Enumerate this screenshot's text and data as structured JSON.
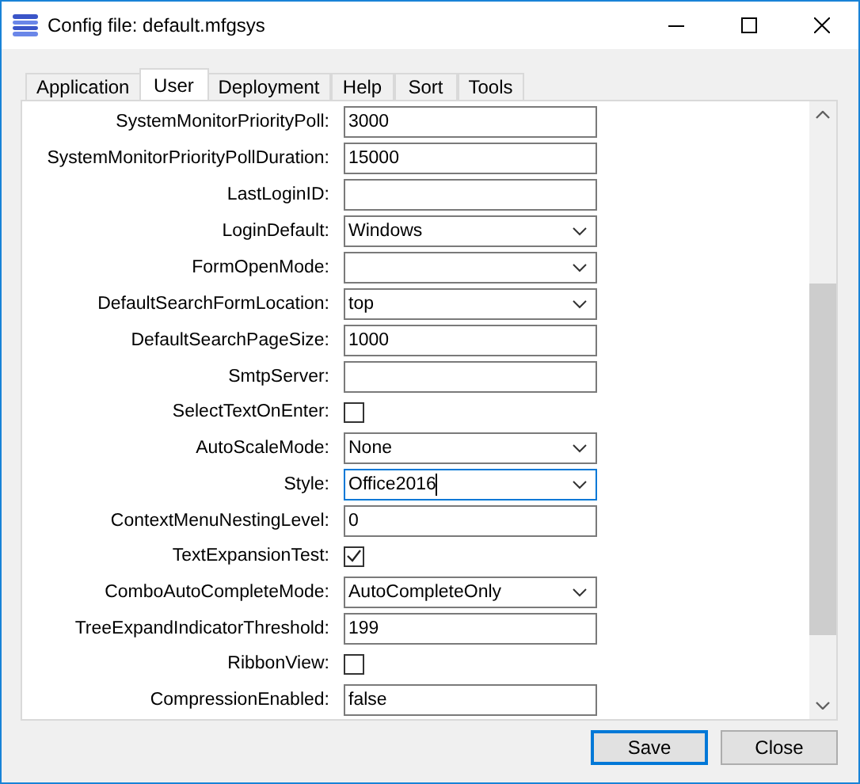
{
  "window": {
    "title": "Config file: default.mfgsys"
  },
  "tabs": [
    {
      "label": "Application",
      "selected": false
    },
    {
      "label": "User",
      "selected": true
    },
    {
      "label": "Deployment",
      "selected": false
    },
    {
      "label": "Help",
      "selected": false
    },
    {
      "label": "Sort",
      "selected": false
    },
    {
      "label": "Tools",
      "selected": false
    }
  ],
  "settings": [
    {
      "label": "SystemMonitorPriorityPoll:",
      "kind": "text",
      "value": "3000"
    },
    {
      "label": "SystemMonitorPriorityPollDuration:",
      "kind": "text",
      "value": "15000"
    },
    {
      "label": "LastLoginID:",
      "kind": "text"
    },
    {
      "label": "LoginDefault:",
      "kind": "combo",
      "value": "Windows"
    },
    {
      "label": "FormOpenMode:",
      "kind": "combo"
    },
    {
      "label": "DefaultSearchFormLocation:",
      "kind": "combo",
      "value": "top"
    },
    {
      "label": "DefaultSearchPageSize:",
      "kind": "text",
      "value": "1000"
    },
    {
      "label": "SmtpServer:",
      "kind": "text"
    },
    {
      "label": "SelectTextOnEnter:",
      "kind": "checkbox",
      "checked": false
    },
    {
      "label": "AutoScaleMode:",
      "kind": "combo",
      "value": "None"
    },
    {
      "label": "Style:",
      "kind": "combo",
      "value": "Office2016",
      "focused": true
    },
    {
      "label": "ContextMenuNestingLevel:",
      "kind": "text",
      "value": "0"
    },
    {
      "label": "TextExpansionTest:",
      "kind": "checkbox",
      "checked": true
    },
    {
      "label": "ComboAutoCompleteMode:",
      "kind": "combo",
      "value": "AutoCompleteOnly"
    },
    {
      "label": "TreeExpandIndicatorThreshold:",
      "kind": "text",
      "value": "199"
    },
    {
      "label": "RibbonView:",
      "kind": "checkbox",
      "checked": false
    },
    {
      "label": "CompressionEnabled:",
      "kind": "text",
      "value": "false"
    }
  ],
  "buttons": [
    {
      "label": "Save",
      "default": true
    },
    {
      "label": "Close",
      "default": false
    }
  ]
}
